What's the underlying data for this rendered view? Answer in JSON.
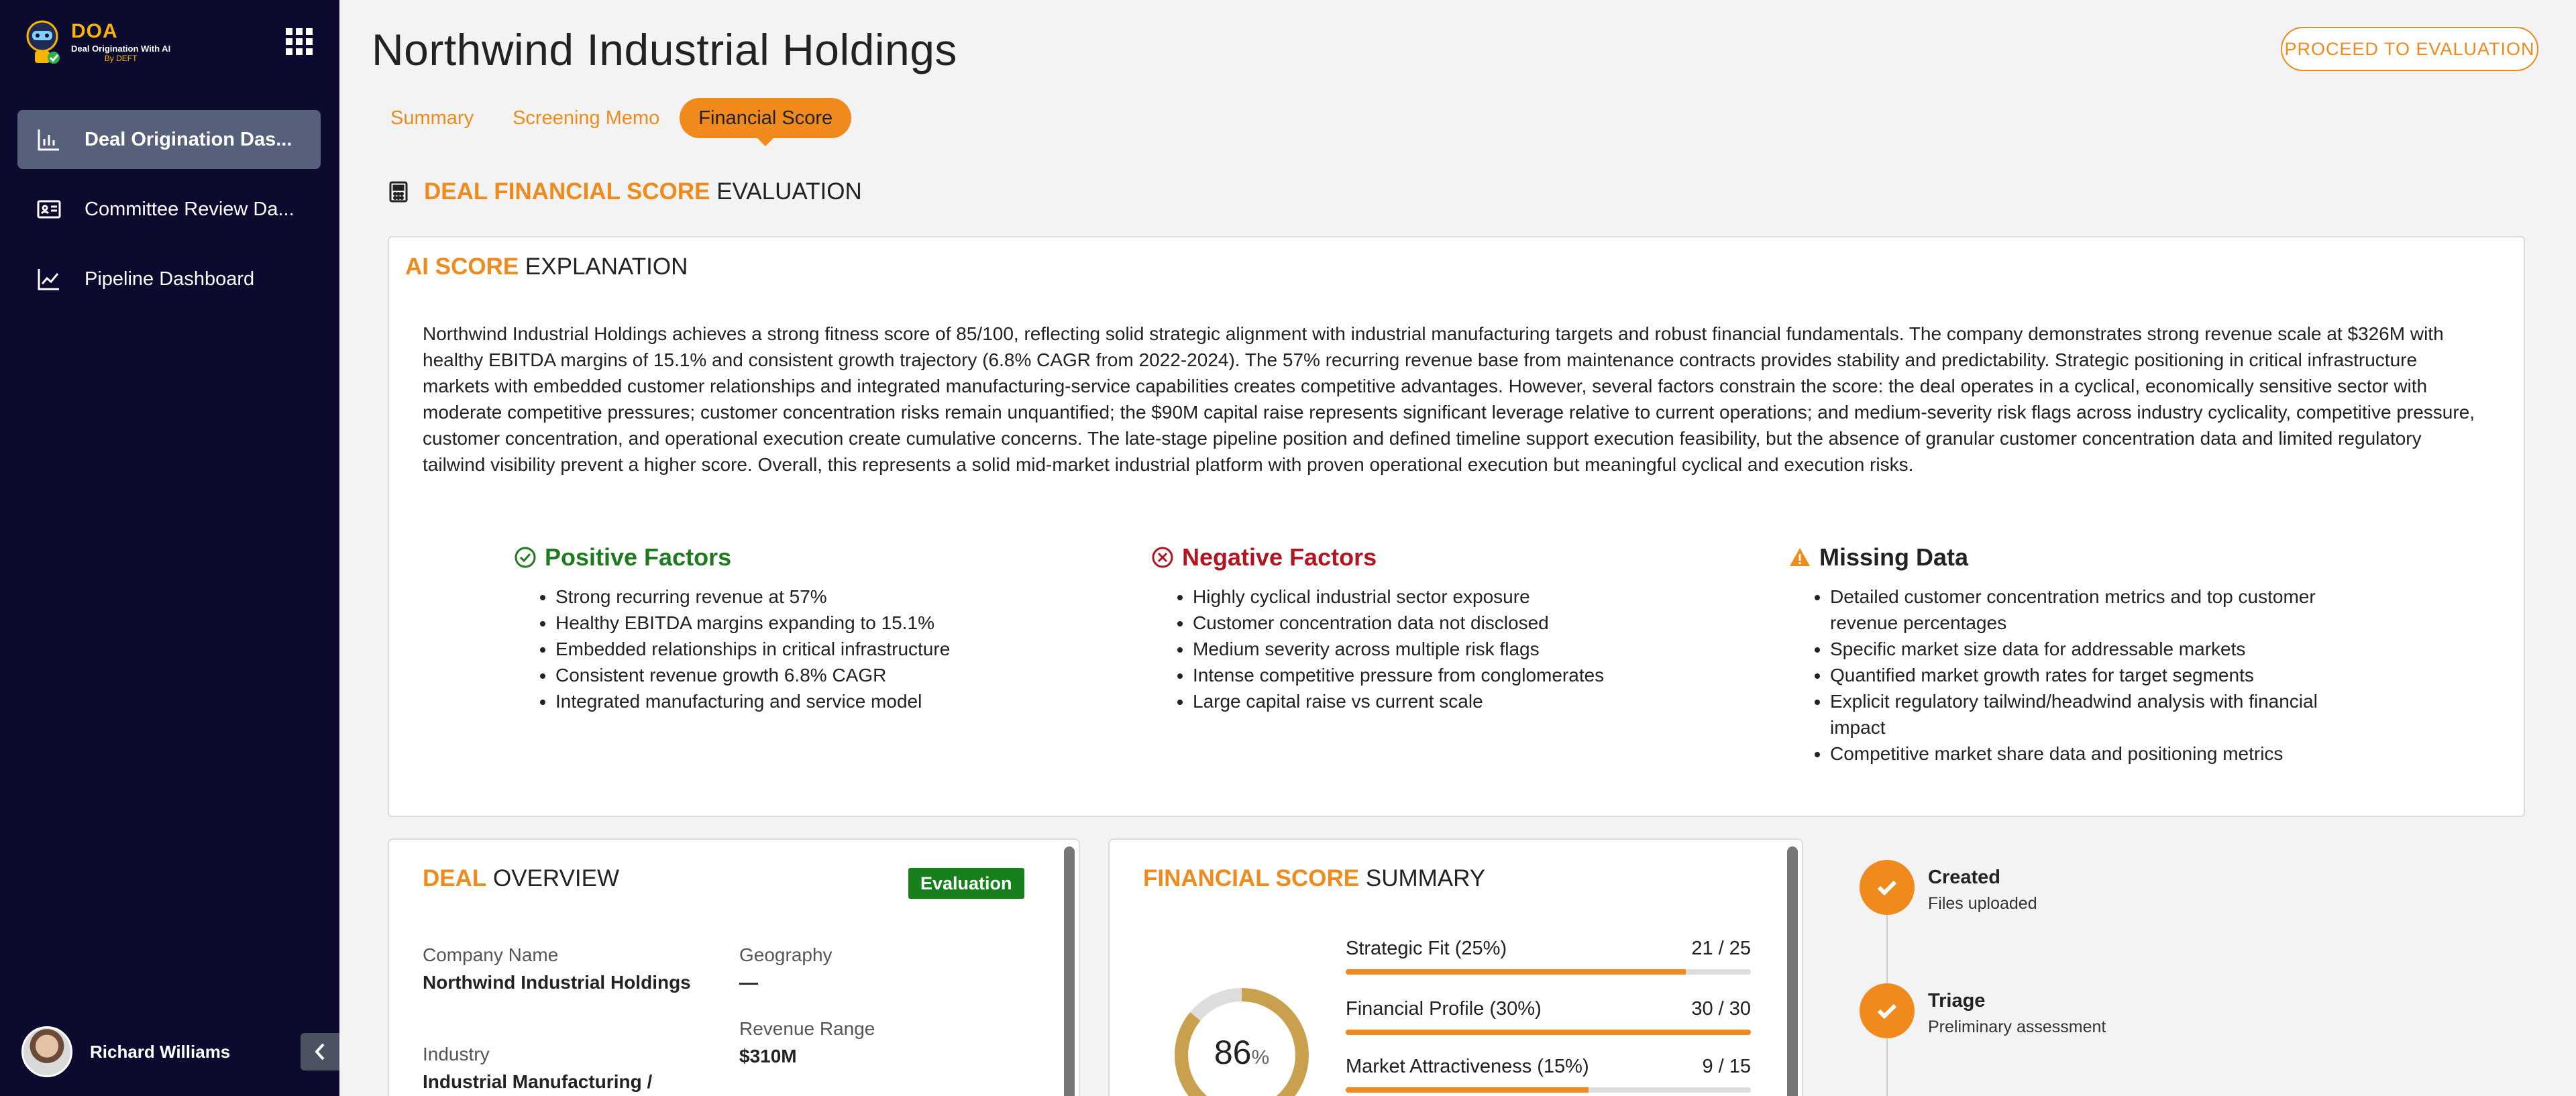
{
  "brand": {
    "logo_title": "DOA",
    "logo_sub": "Deal Origination With AI",
    "logo_sub2": "By DEFT"
  },
  "sidebar": {
    "items": [
      {
        "label": "Deal Origination Das...",
        "icon": "bar-chart-icon",
        "active": true
      },
      {
        "label": "Committee Review Da...",
        "icon": "id-card-icon",
        "active": false
      },
      {
        "label": "Pipeline Dashboard",
        "icon": "line-chart-icon",
        "active": false
      }
    ],
    "user_name": "Richard Williams"
  },
  "header": {
    "title": "Northwind Industrial Holdings",
    "proceed_label": "PROCEED TO EVALUATION",
    "tabs": [
      {
        "label": "Summary",
        "active": false
      },
      {
        "label": "Screening Memo",
        "active": false
      },
      {
        "label": "Financial Score",
        "active": true
      }
    ]
  },
  "section": {
    "heading_accent": "DEAL FINANCIAL SCORE",
    "heading_rest": " EVALUATION"
  },
  "ai": {
    "title_accent": "AI SCORE",
    "title_rest": " EXPLANATION",
    "explanation": "Northwind Industrial Holdings achieves a strong fitness score of 85/100, reflecting solid strategic alignment with industrial manufacturing targets and robust financial fundamentals. The company demonstrates strong revenue scale at $326M with healthy EBITDA margins of 15.1% and consistent growth trajectory (6.8% CAGR from 2022-2024). The 57% recurring revenue base from maintenance contracts provides stability and predictability. Strategic positioning in critical infrastructure markets with embedded customer relationships and integrated manufacturing-service capabilities creates competitive advantages. However, several factors constrain the score: the deal operates in a cyclical, economically sensitive sector with moderate competitive pressures; customer concentration risks remain unquantified; the $90M capital raise represents significant leverage relative to current operations; and medium-severity risk flags across industry cyclicality, competitive pressure, customer concentration, and operational execution create cumulative concerns. The late-stage pipeline position and defined timeline support execution feasibility, but the absence of granular customer concentration data and limited regulatory tailwind visibility prevent a higher score. Overall, this represents a solid mid-market industrial platform with proven operational execution but meaningful cyclical and execution risks.",
    "positive": {
      "title": "Positive Factors",
      "items": [
        "Strong recurring revenue at 57%",
        "Healthy EBITDA margins expanding to 15.1%",
        "Embedded relationships in critical infrastructure",
        "Consistent revenue growth 6.8% CAGR",
        "Integrated manufacturing and service model"
      ]
    },
    "negative": {
      "title": "Negative Factors",
      "items": [
        "Highly cyclical industrial sector exposure",
        "Customer concentration data not disclosed",
        "Medium severity across multiple risk flags",
        "Intense competitive pressure from conglomerates",
        "Large capital raise vs current scale"
      ]
    },
    "missing": {
      "title": "Missing Data",
      "items": [
        "Detailed customer concentration metrics and top customer revenue percentages",
        "Specific market size data for addressable markets",
        "Quantified market growth rates for target segments",
        "Explicit regulatory tailwind/headwind analysis with financial impact",
        "Competitive market share data and positioning metrics"
      ]
    }
  },
  "overview": {
    "title_accent": "DEAL",
    "title_rest": " OVERVIEW",
    "badge": "Evaluation",
    "company_label": "Company Name",
    "company_value": "Northwind Industrial Holdings",
    "geo_label": "Geography",
    "geo_value": "—",
    "industry_label": "Industry",
    "industry_value": "Industrial Manufacturing /",
    "revenue_label": "Revenue Range",
    "revenue_value": "$310M"
  },
  "financial_summary": {
    "title_accent": "FINANCIAL SCORE",
    "title_rest": " SUMMARY",
    "score_value": "86",
    "score_unit": "%",
    "score_fraction": 0.86,
    "metrics": [
      {
        "label": "Strategic Fit (25%)",
        "value": "21 / 25",
        "fraction": 0.84
      },
      {
        "label": "Financial Profile (30%)",
        "value": "30 / 30",
        "fraction": 1.0
      },
      {
        "label": "Market Attractiveness (15%)",
        "value": "9 / 15",
        "fraction": 0.6
      }
    ]
  },
  "timeline": {
    "steps": [
      {
        "title": "Created",
        "sub": "Files uploaded"
      },
      {
        "title": "Triage",
        "sub": "Preliminary assessment"
      }
    ]
  },
  "colors": {
    "accent": "#f08a1c",
    "sidebar_bg": "#0c0a2e",
    "positive": "#1d7a1d",
    "negative": "#b3141f",
    "badge": "#17801d",
    "gauge": "#c9a04d"
  }
}
